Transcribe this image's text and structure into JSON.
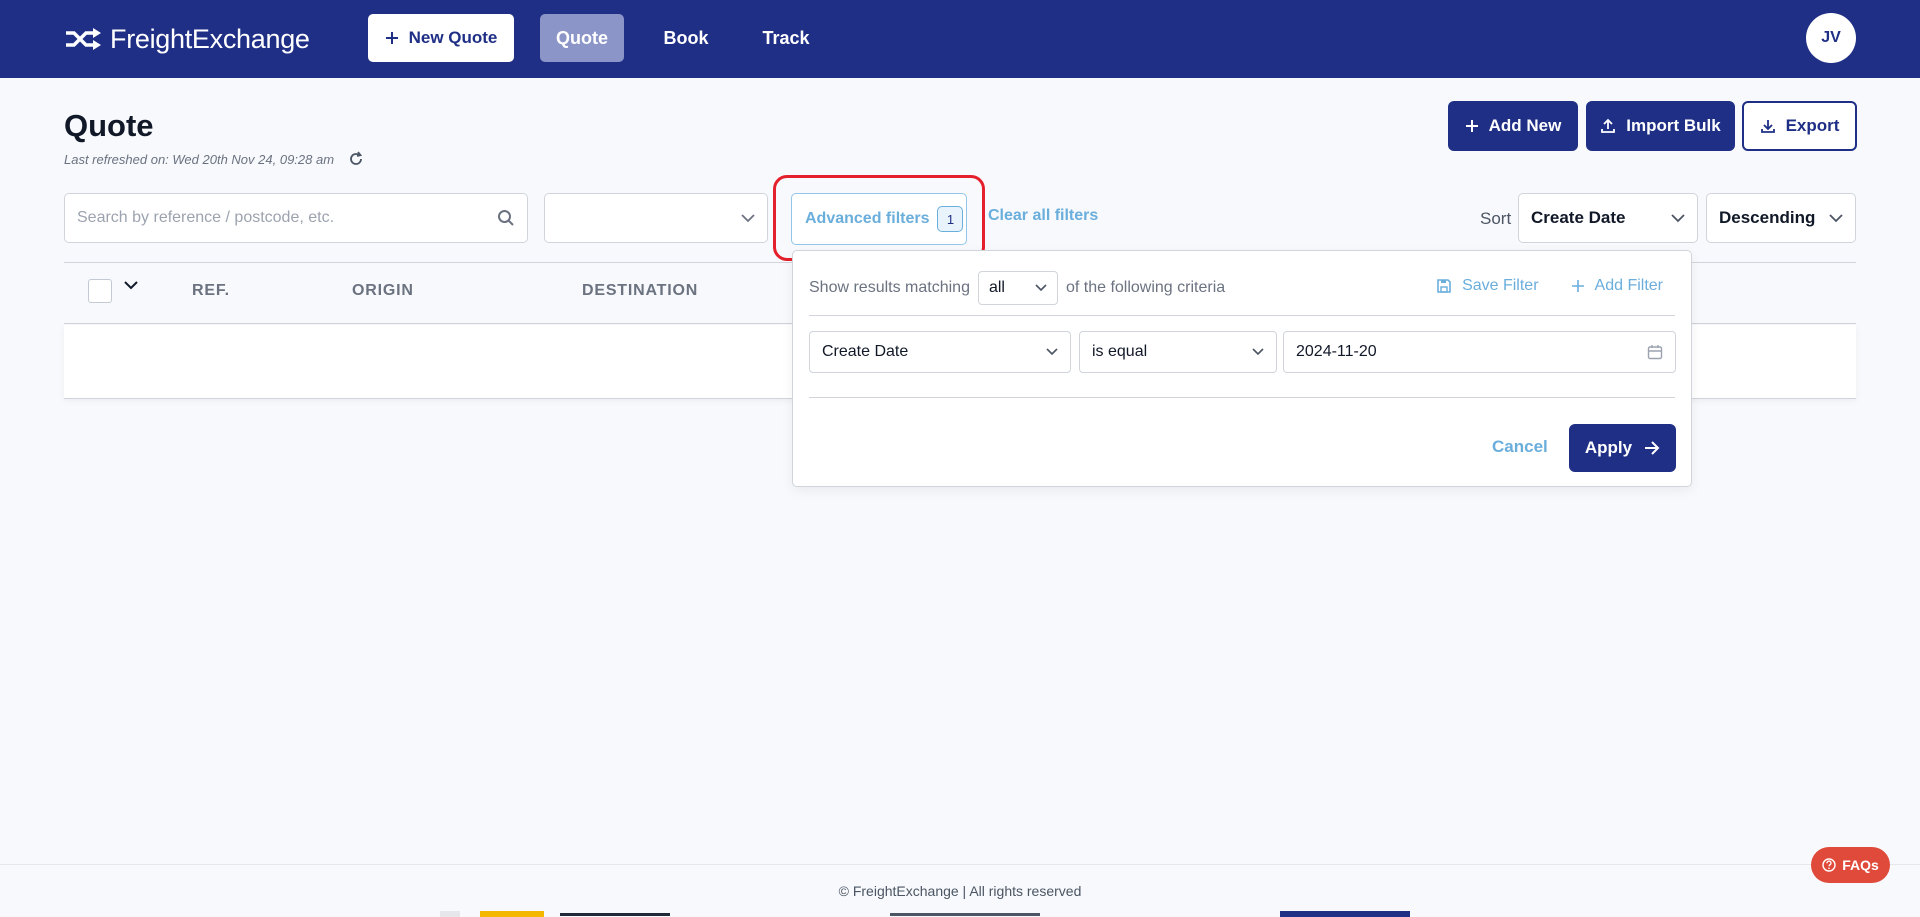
{
  "header": {
    "brand": "FreightExchange",
    "new_quote_label": "New Quote",
    "tabs": [
      "Quote",
      "Book",
      "Track"
    ],
    "active_tab": "Quote",
    "avatar_initials": "JV"
  },
  "page": {
    "title": "Quote",
    "last_refreshed": "Last refreshed on: Wed 20th Nov 24, 09:28 am",
    "actions": {
      "add_new": "Add New",
      "import_bulk": "Import Bulk",
      "export": "Export"
    }
  },
  "filters": {
    "search_placeholder": "Search by reference / postcode, etc.",
    "advanced_label": "Advanced filters",
    "advanced_count": "1",
    "clear_all": "Clear all filters",
    "sort_label": "Sort",
    "sort_field": "Create Date",
    "sort_direction": "Descending"
  },
  "table": {
    "columns": [
      "REF.",
      "ORIGIN",
      "DESTINATION"
    ]
  },
  "advanced_popover": {
    "prefix": "Show results matching",
    "match_value": "all",
    "suffix": "of the following criteria",
    "save_filter": "Save Filter",
    "add_filter": "Add Filter",
    "criteria": {
      "field": "Create Date",
      "operator": "is equal",
      "value": "2024-11-20"
    },
    "cancel": "Cancel",
    "apply": "Apply"
  },
  "footer": {
    "copyright": "© FreightExchange | All rights reserved",
    "faq_label": "FAQs"
  },
  "colors": {
    "primary": "#1f2f86",
    "accent": "#6aaedc",
    "highlight": "#e3202c",
    "faq": "#e04a3a"
  }
}
